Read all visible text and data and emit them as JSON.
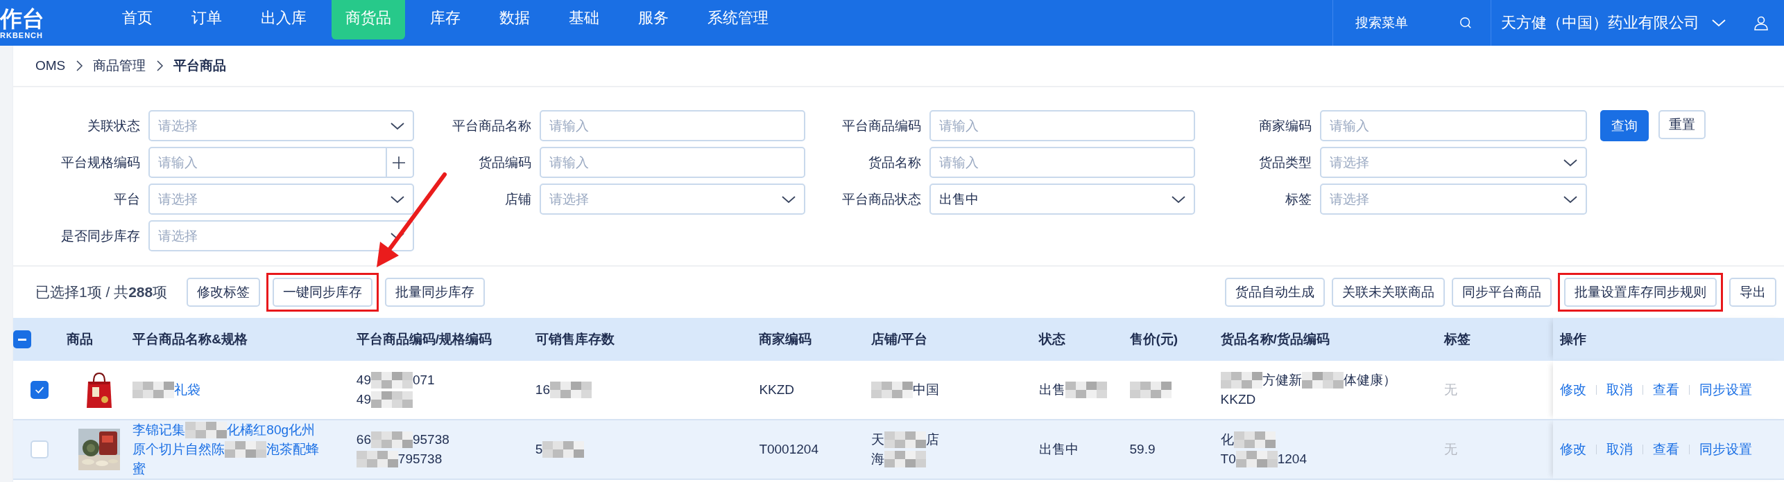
{
  "logo": {
    "title": "作台",
    "subtitle": "RKBENCH"
  },
  "nav": [
    {
      "label": "首页",
      "selected": false
    },
    {
      "label": "订单",
      "selected": false
    },
    {
      "label": "出入库",
      "selected": false
    },
    {
      "label": "商货品",
      "selected": true
    },
    {
      "label": "库存",
      "selected": false
    },
    {
      "label": "数据",
      "selected": false
    },
    {
      "label": "基础",
      "selected": false
    },
    {
      "label": "服务",
      "selected": false
    },
    {
      "label": "系统管理",
      "selected": false
    }
  ],
  "search_menu": {
    "placeholder": "搜索菜单"
  },
  "company": {
    "name": "天方健（中国）药业有限公司"
  },
  "breadcrumb": [
    {
      "label": "OMS",
      "current": false
    },
    {
      "label": "商品管理",
      "current": false
    },
    {
      "label": "平台商品",
      "current": true
    }
  ],
  "filters": [
    {
      "label": "关联状态",
      "kind": "select",
      "placeholder": "请选择"
    },
    {
      "label": "平台商品名称",
      "kind": "input",
      "placeholder": "请输入"
    },
    {
      "label": "平台商品编码",
      "kind": "input",
      "placeholder": "请输入"
    },
    {
      "label": "商家编码",
      "kind": "input",
      "placeholder": "请输入"
    },
    {
      "label": "平台规格编码",
      "kind": "input_add",
      "placeholder": "请输入"
    },
    {
      "label": "货品编码",
      "kind": "input",
      "placeholder": "请输入"
    },
    {
      "label": "货品名称",
      "kind": "input",
      "placeholder": "请输入"
    },
    {
      "label": "货品类型",
      "kind": "select",
      "placeholder": "请选择"
    },
    {
      "label": "平台",
      "kind": "select",
      "placeholder": "请选择"
    },
    {
      "label": "店铺",
      "kind": "select",
      "placeholder": "请选择"
    },
    {
      "label": "平台商品状态",
      "kind": "select",
      "value": "出售中"
    },
    {
      "label": "标签",
      "kind": "select",
      "placeholder": "请选择"
    },
    {
      "label": "是否同步库存",
      "kind": "select",
      "placeholder": "请选择"
    }
  ],
  "filter_buttons": [
    {
      "label": "查询",
      "kind": "primary"
    },
    {
      "label": "重置",
      "kind": "default"
    }
  ],
  "selection_summary": "已选择1项 / 共**288**项",
  "left_actions": [
    {
      "label": "修改标签",
      "highlighted": false
    },
    {
      "label": "一键同步库存",
      "highlighted": true
    },
    {
      "label": "批量同步库存",
      "highlighted": false
    }
  ],
  "right_actions": [
    {
      "label": "货品自动生成",
      "highlighted": false
    },
    {
      "label": "关联未关联商品",
      "highlighted": false
    },
    {
      "label": "同步平台商品",
      "highlighted": false
    },
    {
      "label": "批量设置库存同步规则",
      "highlighted": true
    },
    {
      "label": "导出",
      "highlighted": false
    }
  ],
  "annotations": [
    {
      "kind": "arrow"
    }
  ],
  "table": {
    "header_checkbox": {
      "indeterminate": true
    },
    "columns": [
      "商品",
      "平台商品名称&规格",
      "平台商品编码/规格编码",
      "可销售库存数",
      "商家编码",
      "店铺/平台",
      "状态",
      "售价(元)",
      "货品名称/货品编码",
      "标签",
      "操作"
    ],
    "rows": [
      {
        "selected": true,
        "hovered": false,
        "image": {
          "kind": "picture"
        },
        "name": [
          [
            {
              "kind": "mosaic"
            },
            {
              "kind": "text",
              "text": "礼袋"
            }
          ]
        ],
        "code": [
          [
            {
              "kind": "text",
              "text": "49"
            },
            {
              "kind": "mosaic"
            },
            {
              "kind": "text",
              "text": "071"
            }
          ],
          [
            {
              "kind": "text",
              "text": "49"
            },
            {
              "kind": "mosaic"
            }
          ]
        ],
        "stock": [
          [
            {
              "kind": "text",
              "text": "16"
            },
            {
              "kind": "mosaic"
            }
          ]
        ],
        "merchant_code": "KKZD",
        "shop": [
          [
            {
              "kind": "mosaic"
            },
            {
              "kind": "text",
              "text": "中国"
            }
          ]
        ],
        "status": [
          [
            {
              "kind": "text",
              "text": "出售"
            },
            {
              "kind": "mosaic"
            }
          ]
        ],
        "price": [
          [
            {
              "kind": "mosaic"
            }
          ]
        ],
        "goods": [
          [
            {
              "kind": "mosaic"
            },
            {
              "kind": "text",
              "text": "方健新"
            },
            {
              "kind": "mosaic"
            },
            {
              "kind": "text",
              "text": "体健康）"
            }
          ],
          [
            {
              "kind": "text",
              "text": "KKZD"
            }
          ]
        ],
        "tag": "无",
        "actions": [
          "修改",
          "取消",
          "查看",
          "同步设置"
        ]
      },
      {
        "selected": false,
        "hovered": true,
        "image": {
          "kind": "picture"
        },
        "name": [
          [
            {
              "kind": "text",
              "text": "李锦记集"
            },
            {
              "kind": "mosaic"
            },
            {
              "kind": "text",
              "text": "化橘红80g化州"
            }
          ],
          [
            {
              "kind": "text",
              "text": "原个切片自然陈"
            },
            {
              "kind": "mosaic"
            },
            {
              "kind": "text",
              "text": "泡茶配蜂"
            }
          ],
          [
            {
              "kind": "text",
              "text": "蜜"
            }
          ]
        ],
        "code": [
          [
            {
              "kind": "text",
              "text": "66"
            },
            {
              "kind": "mosaic"
            },
            {
              "kind": "text",
              "text": "95738"
            }
          ],
          [
            {
              "kind": "mosaic"
            },
            {
              "kind": "text",
              "text": "795738"
            }
          ]
        ],
        "stock": [
          [
            {
              "kind": "text",
              "text": "5"
            },
            {
              "kind": "mosaic"
            }
          ]
        ],
        "merchant_code": "T0001204",
        "shop": [
          [
            {
              "kind": "text",
              "text": "天"
            },
            {
              "kind": "mosaic"
            },
            {
              "kind": "text",
              "text": "店"
            }
          ],
          [
            {
              "kind": "text",
              "text": "海"
            },
            {
              "kind": "mosaic"
            }
          ]
        ],
        "status": [
          [
            {
              "kind": "text",
              "text": "出售中"
            }
          ]
        ],
        "price": [
          [
            {
              "kind": "text",
              "text": "59.9"
            }
          ]
        ],
        "goods": [
          [
            {
              "kind": "text",
              "text": "化"
            },
            {
              "kind": "mosaic"
            }
          ],
          [
            {
              "kind": "text",
              "text": "T0"
            },
            {
              "kind": "mosaic"
            },
            {
              "kind": "text",
              "text": "1204"
            }
          ]
        ],
        "tag": "无",
        "actions": [
          "修改",
          "取消",
          "查看",
          "同步设置"
        ]
      }
    ]
  }
}
